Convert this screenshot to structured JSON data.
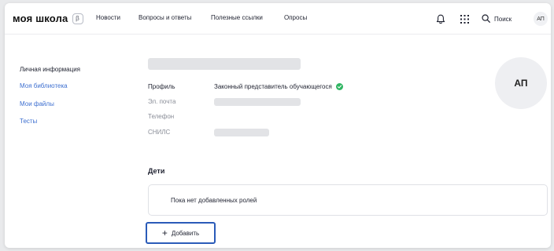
{
  "header": {
    "logo": "моя школа",
    "beta": "β",
    "nav": [
      "Новости",
      "Вопросы и ответы",
      "Полезные ссылки",
      "Опросы"
    ],
    "search_label": "Поиск",
    "user_initials": "АП",
    "icons": [
      "bell-icon",
      "apps-grid-icon",
      "search-icon"
    ]
  },
  "sidebar": {
    "items": [
      {
        "label": "Личная информация"
      },
      {
        "label": "Моя библиотека"
      },
      {
        "label": "Мои файлы"
      },
      {
        "label": "Тесты"
      }
    ]
  },
  "profile": {
    "fields": [
      {
        "label": "Профиль",
        "value": "Законный представитель обучающегося"
      },
      {
        "label": "Эл. почта"
      },
      {
        "label": "Телефон"
      },
      {
        "label": "СНИЛС"
      }
    ],
    "avatar_initials": "АП"
  },
  "children": {
    "title": "Дети",
    "empty_text": "Пока нет добавленных ролей",
    "add_label": "Добавить"
  },
  "colors": {
    "accent": "#3d6fd0",
    "focus_border": "#2a5bb8",
    "verified": "#2fb562"
  }
}
